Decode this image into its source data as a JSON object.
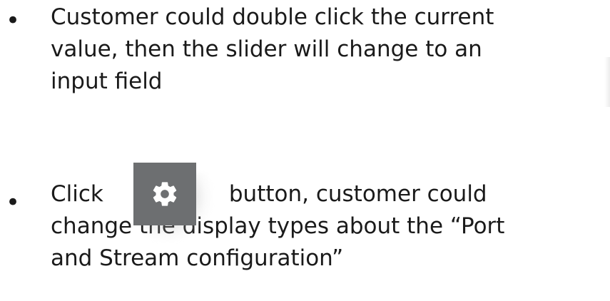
{
  "bullets": [
    {
      "lines": [
        "Customer could double click the current",
        "value, then the slider will change to an",
        "input field"
      ]
    },
    {
      "prefix": "Click",
      "suffix": "button, customer could",
      "lines": [
        "change the display types about the “Port",
        "and Stream configuration”"
      ],
      "icon": "gear-icon"
    }
  ],
  "bullet_symbol": "•",
  "colors": {
    "text": "#1a1a1a",
    "gear_button_bg": "#6d6f71",
    "gear_icon": "#ffffff"
  }
}
